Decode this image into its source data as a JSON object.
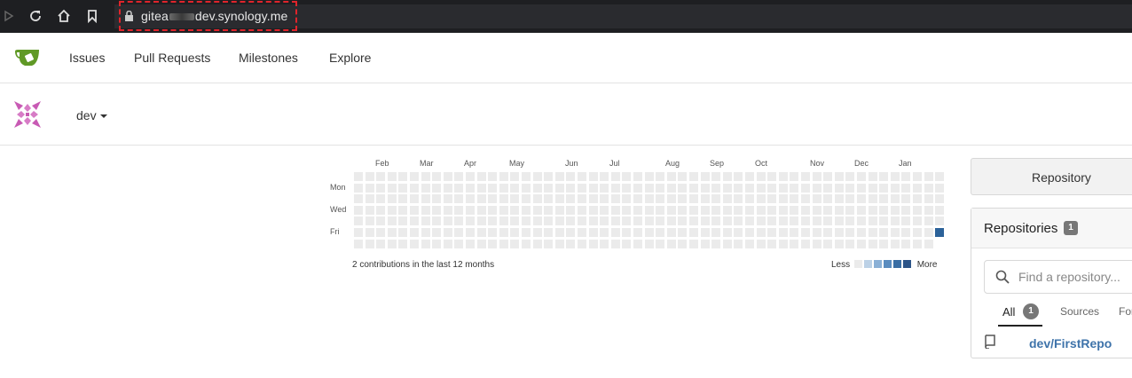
{
  "browser": {
    "url_prefix": "gitea",
    "url_suffix": "dev.synology.me"
  },
  "nav": {
    "items": [
      {
        "label": "Issues"
      },
      {
        "label": "Pull Requests"
      },
      {
        "label": "Milestones"
      },
      {
        "label": "Explore"
      }
    ]
  },
  "user": {
    "name": "dev"
  },
  "heatmap": {
    "months": [
      "Feb",
      "Mar",
      "Apr",
      "May",
      "Jun",
      "Jul",
      "Aug",
      "Sep",
      "Oct",
      "Nov",
      "Dec",
      "Jan"
    ],
    "days": [
      "Mon",
      "Wed",
      "Fri"
    ],
    "summary": "2 contributions in the last 12 months",
    "legend_less": "Less",
    "legend_more": "More",
    "legend_colors": [
      "#ebebeb",
      "#bcd1e6",
      "#8ab0d6",
      "#5a8cbf",
      "#3a6ea4",
      "#2c5488"
    ],
    "active_color": "#2c6299",
    "active_week": 52,
    "active_day": 5
  },
  "sidebar": {
    "repository_button": "Repository",
    "repos_title": "Repositories",
    "repos_count": "1",
    "search_placeholder": "Find a repository...",
    "tabs": [
      {
        "label": "All",
        "count": "1"
      },
      {
        "label": "Sources"
      },
      {
        "label": "Forks"
      }
    ],
    "repos": [
      {
        "name": "dev/FirstRepo"
      }
    ]
  }
}
